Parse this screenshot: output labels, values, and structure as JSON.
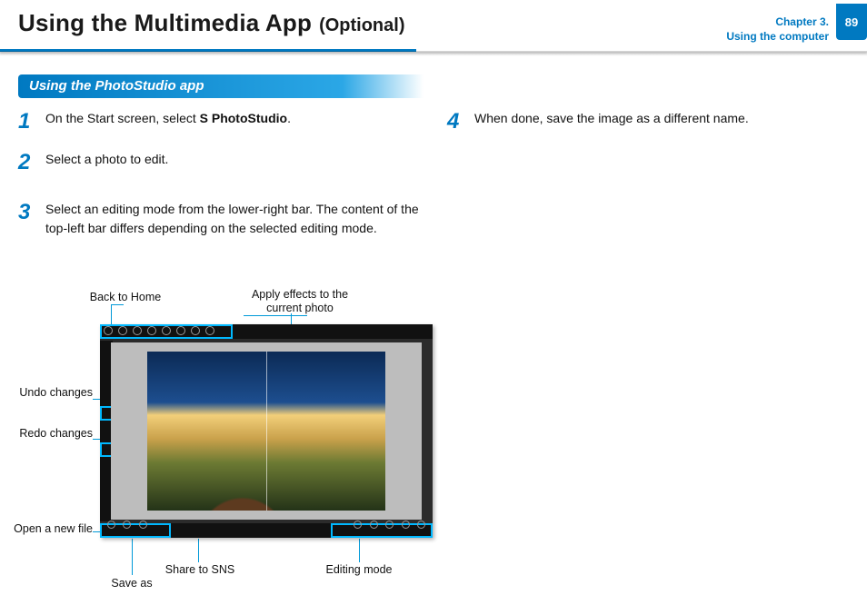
{
  "header": {
    "title": "Using the Multimedia App",
    "title_suffix": "(Optional)",
    "chapter_line1": "Chapter 3.",
    "chapter_line2": "Using the computer",
    "page_number": "89"
  },
  "section": {
    "banner": "Using the PhotoStudio app"
  },
  "steps": {
    "s1_num": "1",
    "s1_pre": "On the Start screen, select ",
    "s1_bold": "S PhotoStudio",
    "s1_post": ".",
    "s2_num": "2",
    "s2_text": "Select a photo to edit.",
    "s3_num": "3",
    "s3_text": "Select an editing mode from the lower-right bar. The content of the top-left bar differs depending on the selected editing mode.",
    "s4_num": "4",
    "s4_text": "When done, save the image as a different name."
  },
  "annotations": {
    "back_home": "Back to Home",
    "apply_effects": "Apply effects to the current photo",
    "undo": "Undo changes",
    "redo": "Redo changes",
    "open_new": "Open a new file",
    "save_as": "Save as",
    "share_sns": "Share to SNS",
    "editing_mode": "Editing mode"
  }
}
